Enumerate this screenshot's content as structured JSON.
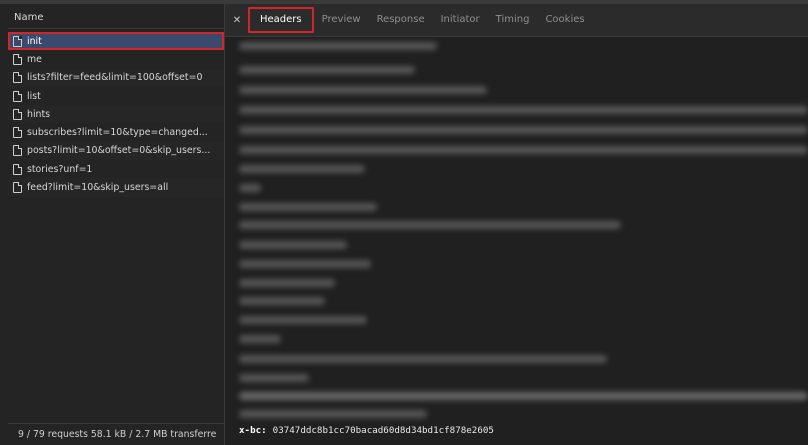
{
  "network": {
    "name_header": "Name",
    "requests": [
      "init",
      "me",
      "lists?filter=feed&limit=100&offset=0",
      "list",
      "hints",
      "subscribes?limit=10&type=changed...",
      "posts?limit=10&offset=0&skip_users...",
      "stories?unf=1",
      "feed?limit=10&skip_users=all"
    ],
    "status": "9 / 79 requests   58.1 kB / 2.7 MB transferre"
  },
  "details": {
    "tabs": [
      "Headers",
      "Preview",
      "Response",
      "Initiator",
      "Timing",
      "Cookies"
    ],
    "header_key": "x-bc:",
    "header_value": "03747ddc8b1cc70bacad60d8d34bd1cf878e2605"
  },
  "colors": {
    "highlight": "#d3262a",
    "panel_bg": "#242424",
    "selected_bg": "#3a4a6a"
  },
  "icons": {
    "request": "document-icon",
    "close": "close-icon"
  }
}
